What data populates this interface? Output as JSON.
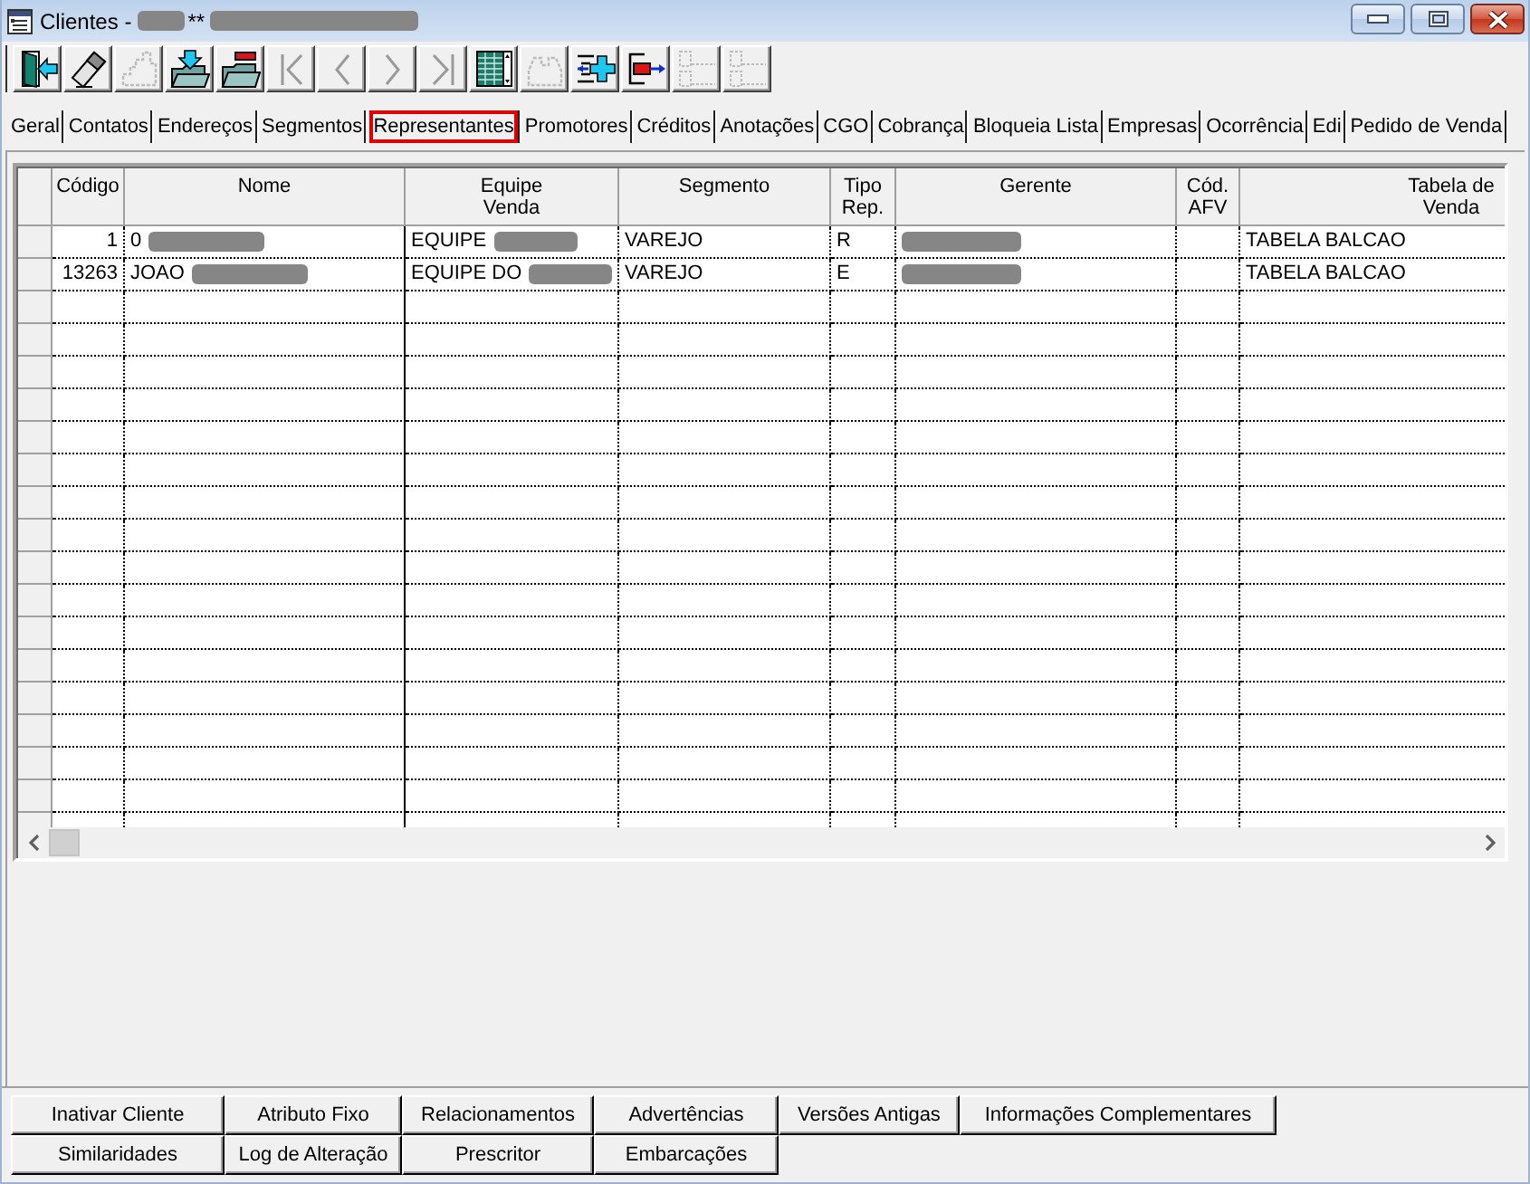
{
  "window": {
    "title_parts": [
      {
        "kind": "text",
        "text": "Clientes -"
      },
      {
        "kind": "redaction"
      },
      {
        "kind": "text",
        "text": "**"
      },
      {
        "kind": "redaction"
      }
    ]
  },
  "toolbar": [
    {
      "kind": "exit",
      "disabled": false
    },
    {
      "kind": "eraser",
      "disabled": false
    },
    {
      "kind": "steps",
      "disabled": true
    },
    {
      "kind": "folder-down",
      "disabled": false
    },
    {
      "kind": "folder-minus",
      "disabled": false
    },
    {
      "kind": "first",
      "disabled": true
    },
    {
      "kind": "prev",
      "disabled": true
    },
    {
      "kind": "next",
      "disabled": true
    },
    {
      "kind": "last",
      "disabled": true
    },
    {
      "kind": "grid",
      "disabled": false
    },
    {
      "kind": "arch",
      "disabled": true
    },
    {
      "kind": "insert",
      "disabled": false
    },
    {
      "kind": "remove",
      "disabled": false
    },
    {
      "kind": "list",
      "disabled": true
    },
    {
      "kind": "list",
      "disabled": true
    }
  ],
  "tabs": [
    {
      "label": "Geral",
      "selected": false
    },
    {
      "label": "Contatos",
      "selected": false
    },
    {
      "label": "Endereços",
      "selected": false
    },
    {
      "label": "Segmentos",
      "selected": false
    },
    {
      "label": "Representantes",
      "selected": true
    },
    {
      "label": "Promotores",
      "selected": false
    },
    {
      "label": "Créditos",
      "selected": false
    },
    {
      "label": "Anotações",
      "selected": false
    },
    {
      "label": "CGO",
      "selected": false
    },
    {
      "label": "Cobrança",
      "selected": false
    },
    {
      "label": "Bloqueia Lista",
      "selected": false
    },
    {
      "label": "Empresas",
      "selected": false
    },
    {
      "label": "Ocorrência",
      "selected": false
    },
    {
      "label": "Edi",
      "selected": false
    },
    {
      "label": "Pedido de Venda",
      "selected": false
    }
  ],
  "grid": {
    "columns": [
      {
        "label": "Código",
        "kind": "number"
      },
      {
        "label": "Nome",
        "kind": "text"
      },
      {
        "label": "Equipe\nVenda",
        "kind": "text"
      },
      {
        "label": "Segmento",
        "kind": "text"
      },
      {
        "label": "Tipo\nRep.",
        "kind": "text"
      },
      {
        "label": "Gerente",
        "kind": "text"
      },
      {
        "label": "Cód.\nAFV",
        "kind": "text"
      },
      {
        "label": "Tabela de\nVenda",
        "kind": "text"
      }
    ],
    "rows": [
      {
        "cells": [
          {
            "text": "1"
          },
          {
            "text": "0",
            "redacted": true
          },
          {
            "text": "EQUIPE",
            "redacted": true
          },
          {
            "text": "VAREJO"
          },
          {
            "text": "R"
          },
          {
            "redacted": true
          },
          {},
          {
            "text": "TABELA BALCAO"
          }
        ]
      },
      {
        "cells": [
          {
            "text": "13263"
          },
          {
            "text": "JOAO",
            "redacted": true
          },
          {
            "text": "EQUIPE DO",
            "redacted": true
          },
          {
            "text": "VAREJO"
          },
          {
            "text": "E"
          },
          {
            "redacted": true
          },
          {},
          {
            "text": "TABELA BALCAO"
          }
        ]
      }
    ]
  },
  "bottom_buttons": [
    "Inativar Cliente",
    "Atributo Fixo",
    "Relacionamentos",
    "Advertências",
    "Versões Antigas",
    "Informações Complementares",
    "Similaridades",
    "Log de Alteração",
    "Prescritor",
    "Embarcações"
  ]
}
